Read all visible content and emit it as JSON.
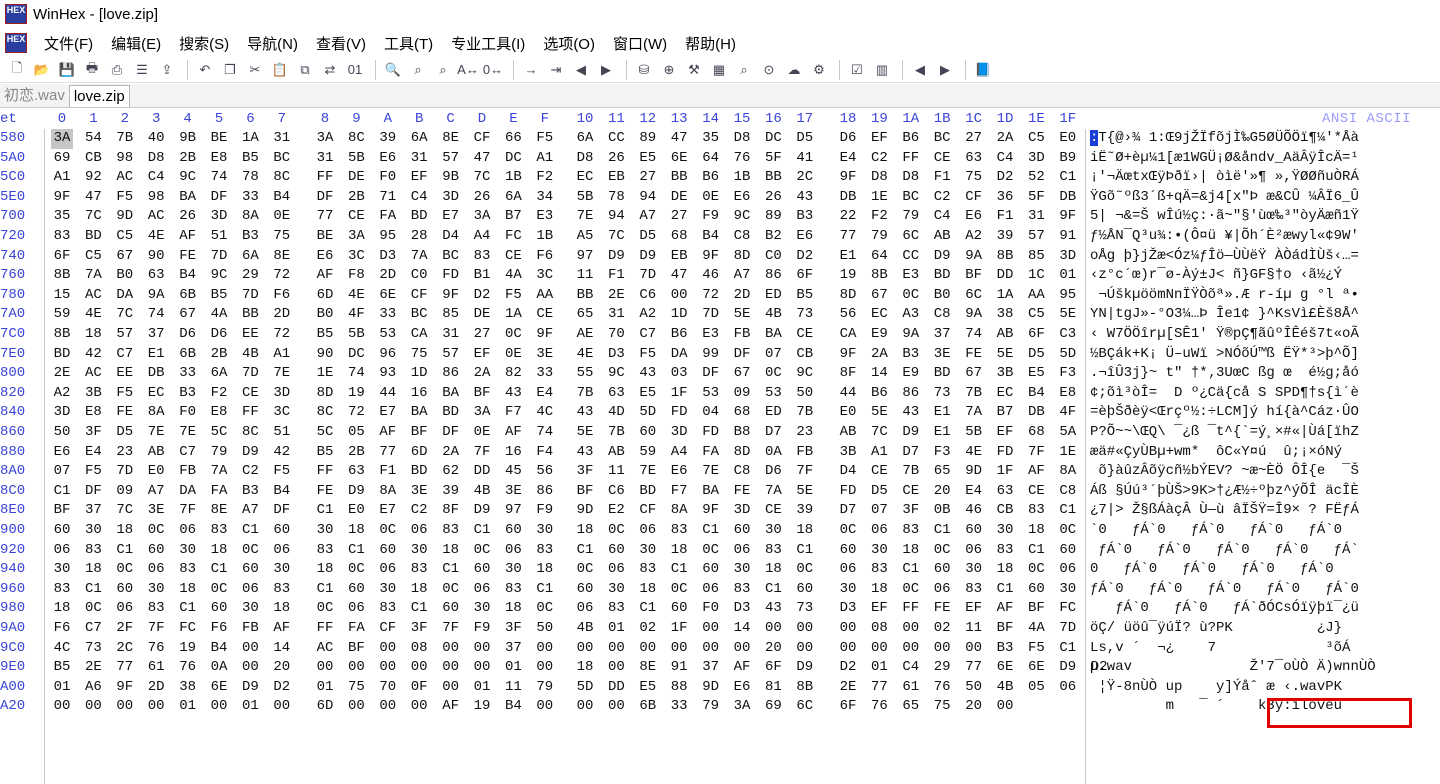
{
  "window": {
    "title": "WinHex - [love.zip]",
    "logo": "HEX"
  },
  "menu": [
    "文件(F)",
    "编辑(E)",
    "搜索(S)",
    "导航(N)",
    "查看(V)",
    "工具(T)",
    "专业工具(I)",
    "选项(O)",
    "窗口(W)",
    "帮助(H)"
  ],
  "toolbar_icons": [
    "new-file-icon",
    "open-folder-icon",
    "save-icon",
    "print-icon",
    "print-setup-icon",
    "properties-icon",
    "open-disk-icon",
    "undo-icon",
    "copy-icon",
    "cut-icon",
    "paste-icon",
    "paste-special-icon",
    "convert-icon",
    "binary-icon",
    "find-icon",
    "find-replace-icon",
    "find-hex-icon",
    "replace-text-icon",
    "replace-hex-icon",
    "goto-offset-icon",
    "goto-block-icon",
    "back-icon",
    "forward-icon",
    "disk-icon",
    "disk-add-icon",
    "disk-tools-icon",
    "calculator-icon",
    "search-disk-icon",
    "zoom-icon",
    "cloud-icon",
    "settings-icon",
    "checklist-icon",
    "columns-icon",
    "prev-icon",
    "next-icon",
    "book-icon"
  ],
  "tabs": [
    {
      "label": "初恋.wav",
      "active": false
    },
    {
      "label": "love.zip",
      "active": true
    }
  ],
  "header": {
    "offset_label": "et",
    "columns": [
      "0",
      "1",
      "2",
      "3",
      "4",
      "5",
      "6",
      "7",
      "8",
      "9",
      "A",
      "B",
      "C",
      "D",
      "E",
      "F",
      "10",
      "11",
      "12",
      "13",
      "14",
      "15",
      "16",
      "17",
      "18",
      "19",
      "1A",
      "1B",
      "1C",
      "1D",
      "1E",
      "1F"
    ],
    "ansi_label": "ANSI ASCII"
  },
  "rows": [
    {
      "offset": "580",
      "hex": "3A 54 7B 40 9B BE 1A 31 3A 8C 39 6A 8E CF 66 F5 6A CC 89 47 35 D8 DC D5 D6 EF B6 BC 27 2A C5 E0",
      "ascii": "T{@›¾ 1:Œ9jŽÏfõjÌ‰G5ØÜÕÖï¶¼'*Åà"
    },
    {
      "offset": "5A0",
      "hex": "69 CB 98 D8 2B E8 B5 BC 31 5B E6 31 57 47 DC A1 D8 26 E5 6E 64 76 5F 41 E4 C2 FF CE 63 C4 3D B9",
      "ascii": "iË˜Ø+èµ¼1[æ1WGÜ¡Ø&åndv_AäÂÿÎcÄ=¹"
    },
    {
      "offset": "5C0",
      "hex": "A1 92 AC C4 9C 74 78 8C FF DE F0 EF 9B 7C 1B F2 EC EB 27 BB B6 1B BB 2C 9F D8 D8 F1 75 D2 52 C1",
      "ascii": "¡'¬ÄœtxŒÿÞðï›| òìë'»¶ »,ŸØØñuÒRÁ"
    },
    {
      "offset": "5E0",
      "hex": "9F 47 F5 98 BA DF 33 B4 DF 2B 71 C4 3D 26 6A 34 5B 78 94 DE 0E E6 26 43 DB 1E BC C2 CF 36 5F DB",
      "ascii": "ŸGõ˜ºß3´ß+qÄ=&j4[x\"Þ æ&CÛ ¼ÂÏ6_Û"
    },
    {
      "offset": "700",
      "hex": "35 7C 9D AC 26 3D 8A 0E 77 CE FA BD E7 3A B7 E3 7E 94 A7 27 F9 9C 89 B3 22 F2 79 C4 E6 F1 31 9F",
      "ascii": "5| ¬&=Š wÎú½ç:·ã~\"§'ùœ‰³\"òyÄæñ1Ÿ"
    },
    {
      "offset": "720",
      "hex": "83 BD C5 4E AF 51 B3 75 BE 3A 95 28 D4 A4 FC 1B A5 7C D5 68 B4 C8 B2 E6 77 79 6C AB A2 39 57 91",
      "ascii": "ƒ½ÅN¯Q³u¾:•(Ô¤ü ¥|Õh´È²æwyl«¢9W'"
    },
    {
      "offset": "740",
      "hex": "6F C5 67 90 FE 7D 6A 8E E6 3C D3 7A BC 83 CE F6 97 D9 D9 EB 9F 8D C0 D2 E1 64 CC D9 9A 8B 85 3D",
      "ascii": "oÅg þ}jŽæ<Óz¼ƒÎö—ÙÙëŸ ÀÒádÌÙš‹…="
    },
    {
      "offset": "760",
      "hex": "8B 7A B0 63 B4 9C 29 72 AF F8 2D C0 FD B1 4A 3C 11 F1 7D 47 46 A7 86 6F 19 8B E3 BD BF DD 1C 01",
      "ascii": "‹z°c´œ)r¯ø-Àý±J< ñ}GF§†o ‹ã½¿Ý"
    },
    {
      "offset": "780",
      "hex": "15 AC DA 9A 6B B5 7D F6 6D 4E 6E CF 9F D2 F5 AA BB 2E C6 00 72 2D ED B5 8D 67 0C B0 6C 1A AA 95",
      "ascii": " ¬ÚškµöömNnÏŸÒõª».Æ r-íµ g °l ª•"
    },
    {
      "offset": "7A0",
      "hex": "59 4E 7C 74 67 4A BB 2D B0 4F 33 BC 85 DE 1A CE 65 31 A2 1D 7D 5E 4B 73 56 EC A3 C8 9A 38 C5 5E",
      "ascii": "YN|tgJ»-°O3¼…Þ Îe1¢ }^KsVì£Èš8Å^"
    },
    {
      "offset": "7C0",
      "hex": "8B 18 57 37 D6 D6 EE 72 B5 5B 53 CA 31 27 0C 9F AE 70 C7 B6 E3 FB BA CE CA E9 9A 37 74 AB 6F C3",
      "ascii": "‹ W7ÖÖîrµ[SÊ1' Ÿ®pÇ¶ãûºÎÊéš7t«oÃ"
    },
    {
      "offset": "7E0",
      "hex": "BD 42 C7 E1 6B 2B 4B A1 90 DC 96 75 57 EF 0E 3E 4E D3 F5 DA 99 DF 07 CB 9F 2A B3 3E FE 5E D5 5D",
      "ascii": "½BÇák+K¡ Ü–uWï >NÓõÚ™ß ËŸ*³>þ^Õ]"
    },
    {
      "offset": "800",
      "hex": "2E AC EE DB 33 6A 7D 7E 1E 74 93 1D 86 2A 82 33 55 9C 43 03 DF 67 0C 9C 8F 14 E9 BD 67 3B E5 F3",
      "ascii": ".¬îÛ3j}~ t\" †*‚3UœC ßg œ  é½g;åó"
    },
    {
      "offset": "820",
      "hex": "A2 3B F5 EC B3 F2 CE 3D 8D 19 44 16 BA BF 43 E4 7B 63 E5 1F 53 09 53 50 44 B6 86 73 7B EC B4 E8",
      "ascii": "¢;õì³òÎ=  D º¿Cä{cå S SPD¶†s{ì´è"
    },
    {
      "offset": "840",
      "hex": "3D E8 FE 8A F0 E8 FF 3C 8C 72 E7 BA BD 3A F7 4C 43 4D 5D FD 04 68 ED 7B E0 5E 43 E1 7A B7 DB 4F",
      "ascii": "=èþŠðèÿ<Œrçº½:÷LCM]ý hí{à^Cáz·ÛO"
    },
    {
      "offset": "860",
      "hex": "50 3F D5 7E 7E 5C 8C 51 5C 05 AF BF DF 0E AF 74 5E 7B 60 3D FD B8 D7 23 AB 7C D9 E1 5B EF 68 5A",
      "ascii": "P?Õ~~\\ŒQ\\ ¯¿ß ¯t^{`=ý¸×#«|Ùá[ïhZ"
    },
    {
      "offset": "880",
      "hex": "E6 E4 23 AB C7 79 D9 42 B5 2B 77 6D 2A 7F 16 F4 43 AB 59 A4 FA 8D 0A FB 3B A1 D7 F3 4E FD 7F 1E",
      "ascii": "æä#«ÇyÙBµ+wm*  ôC«Y¤ú  û;¡×óNý"
    },
    {
      "offset": "8A0",
      "hex": "07 F5 7D E0 FB 7A C2 F5 FF 63 F1 BD 62 DD 45 56 3F 11 7E E6 7E C8 D6 7F D4 CE 7B 65 9D 1F AF 8A",
      "ascii": " õ}àûzÂõÿcñ½bÝEV? ~æ~ÈÖ ÔÎ{e  ¯Š"
    },
    {
      "offset": "8C0",
      "hex": "C1 DF 09 A7 DA FA B3 B4 FE D9 8A 3E 39 4B 3E 86 BF C6 BD F7 BA FE 7A 5E FD D5 CE 20 E4 63 CE C8",
      "ascii": "Áß §Úú³´þÙŠ>9K>†¿Æ½÷ºþz^ýÕÎ äcÎÈ"
    },
    {
      "offset": "8E0",
      "hex": "BF 37 7C 3E 7F 8E A7 DF C1 E0 E7 C2 8F D9 97 F9 9D E2 CF 8A 9F 3D CE 39 D7 07 3F 0B 46 CB 83 C1",
      "ascii": "¿7|> Ž§ßÁàçÂ Ù—ù âÏŠŸ=Î9× ? FËƒÁ"
    },
    {
      "offset": "900",
      "hex": "60 30 18 0C 06 83 C1 60 30 18 0C 06 83 C1 60 30 18 0C 06 83 C1 60 30 18 0C 06 83 C1 60 30 18 0C",
      "ascii": "`0   ƒÁ`0   ƒÁ`0   ƒÁ`0   ƒÁ`0"
    },
    {
      "offset": "920",
      "hex": "06 83 C1 60 30 18 0C 06 83 C1 60 30 18 0C 06 83 C1 60 30 18 0C 06 83 C1 60 30 18 0C 06 83 C1 60",
      "ascii": " ƒÁ`0   ƒÁ`0   ƒÁ`0   ƒÁ`0   ƒÁ`"
    },
    {
      "offset": "940",
      "hex": "30 18 0C 06 83 C1 60 30 18 0C 06 83 C1 60 30 18 0C 06 83 C1 60 30 18 0C 06 83 C1 60 30 18 0C 06",
      "ascii": "0   ƒÁ`0   ƒÁ`0   ƒÁ`0   ƒÁ`0"
    },
    {
      "offset": "960",
      "hex": "83 C1 60 30 18 0C 06 83 C1 60 30 18 0C 06 83 C1 60 30 18 0C 06 83 C1 60 30 18 0C 06 83 C1 60 30",
      "ascii": "ƒÁ`0   ƒÁ`0   ƒÁ`0   ƒÁ`0   ƒÁ`0"
    },
    {
      "offset": "980",
      "hex": "18 0C 06 83 C1 60 30 18 0C 06 83 C1 60 30 18 0C 06 83 C1 60 F0 D3 43 73 D3 EF FF FE EF AF BF FC",
      "ascii": "   ƒÁ`0   ƒÁ`0   ƒÁ`ðÓCsÓïÿþï¯¿ü"
    },
    {
      "offset": "9A0",
      "hex": "F6 C7 2F 7F FC F6 FB AF FF FA CF 3F 7F F9 3F 50 4B 01 02 1F 00 14 00 00 00 08 00 02 11 BF 4A 7D",
      "ascii": "öÇ/ üöû¯ÿúÏ? ù?PK          ¿J}"
    },
    {
      "offset": "9C0",
      "hex": "4C 73 2C 76 19 B4 00 14 AC BF 00 08 00 00 37 00 00 00 00 00 00 00 20 00 00 00 00 00 00 B3 F5 C1",
      "ascii": "Ls,v ´  ¬¿    7             ³õÁ"
    },
    {
      "offset": "9E0",
      "hex": "B5 2E 77 61 76 0A 00 20 00 00 00 00 00 00 01 00 18 00 8E 91 37 AF 6F D9 D2 01 C4 29 77 6E 6E D9 D2",
      "ascii": "µ.wav              Ž'7¯oÙÒ Ä)wnnÙÒ"
    },
    {
      "offset": "A00",
      "hex": "01 A6 9F 2D 38 6E D9 D2 01 75 70 0F 00 01 11 79 5D DD E5 88 9D E6 81 8B 2E 77 61 76 50 4B 05 06",
      "ascii": " ¦Ÿ-8nÙÒ up    y]Ýåˆ æ ‹.wavPK"
    },
    {
      "offset": "A20",
      "hex": "00 00 00 00 01 00 01 00 6D 00 00 00 AF 19 B4 00 00 00 6B 33 79 3A 69 6C 6F 76 65 75 20 00",
      "ascii": "         m   ¯ ´    k3y:iloveu"
    }
  ],
  "status": {
    "annotation": "k3y:iloveu"
  }
}
